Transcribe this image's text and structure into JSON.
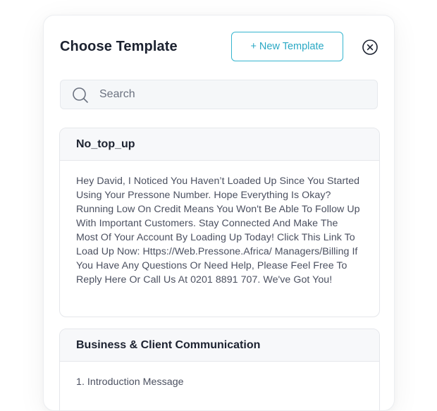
{
  "modal": {
    "title": "Choose Template",
    "new_button_label": "+ New Template",
    "close_icon": "close-circle-icon"
  },
  "search": {
    "placeholder": "Search",
    "icon": "search-icon"
  },
  "templates": [
    {
      "name": "No_top_up",
      "body": "Hey David, I Noticed You Haven’t Loaded Up Since You Started Using Your Pressone Number. Hope Everything Is Okay? Running Low On Credit Means You Won't Be Able To Follow Up With Important Customers. Stay Connected And Make The Most Of Your Account By Loading Up Today! Click This Link To Load Up Now: Https://Web.Pressone.Africa/ Managers/Billing If You Have Any Questions Or Need Help, Please Feel Free To Reply Here Or Call Us At 0201 8891 707. We've Got You!"
    },
    {
      "name": "Business & Client Communication",
      "body": "1. Introduction Message"
    }
  ],
  "colors": {
    "accent": "#2aa8c4",
    "title_text": "#1c2230",
    "body_text": "#4b5060"
  }
}
